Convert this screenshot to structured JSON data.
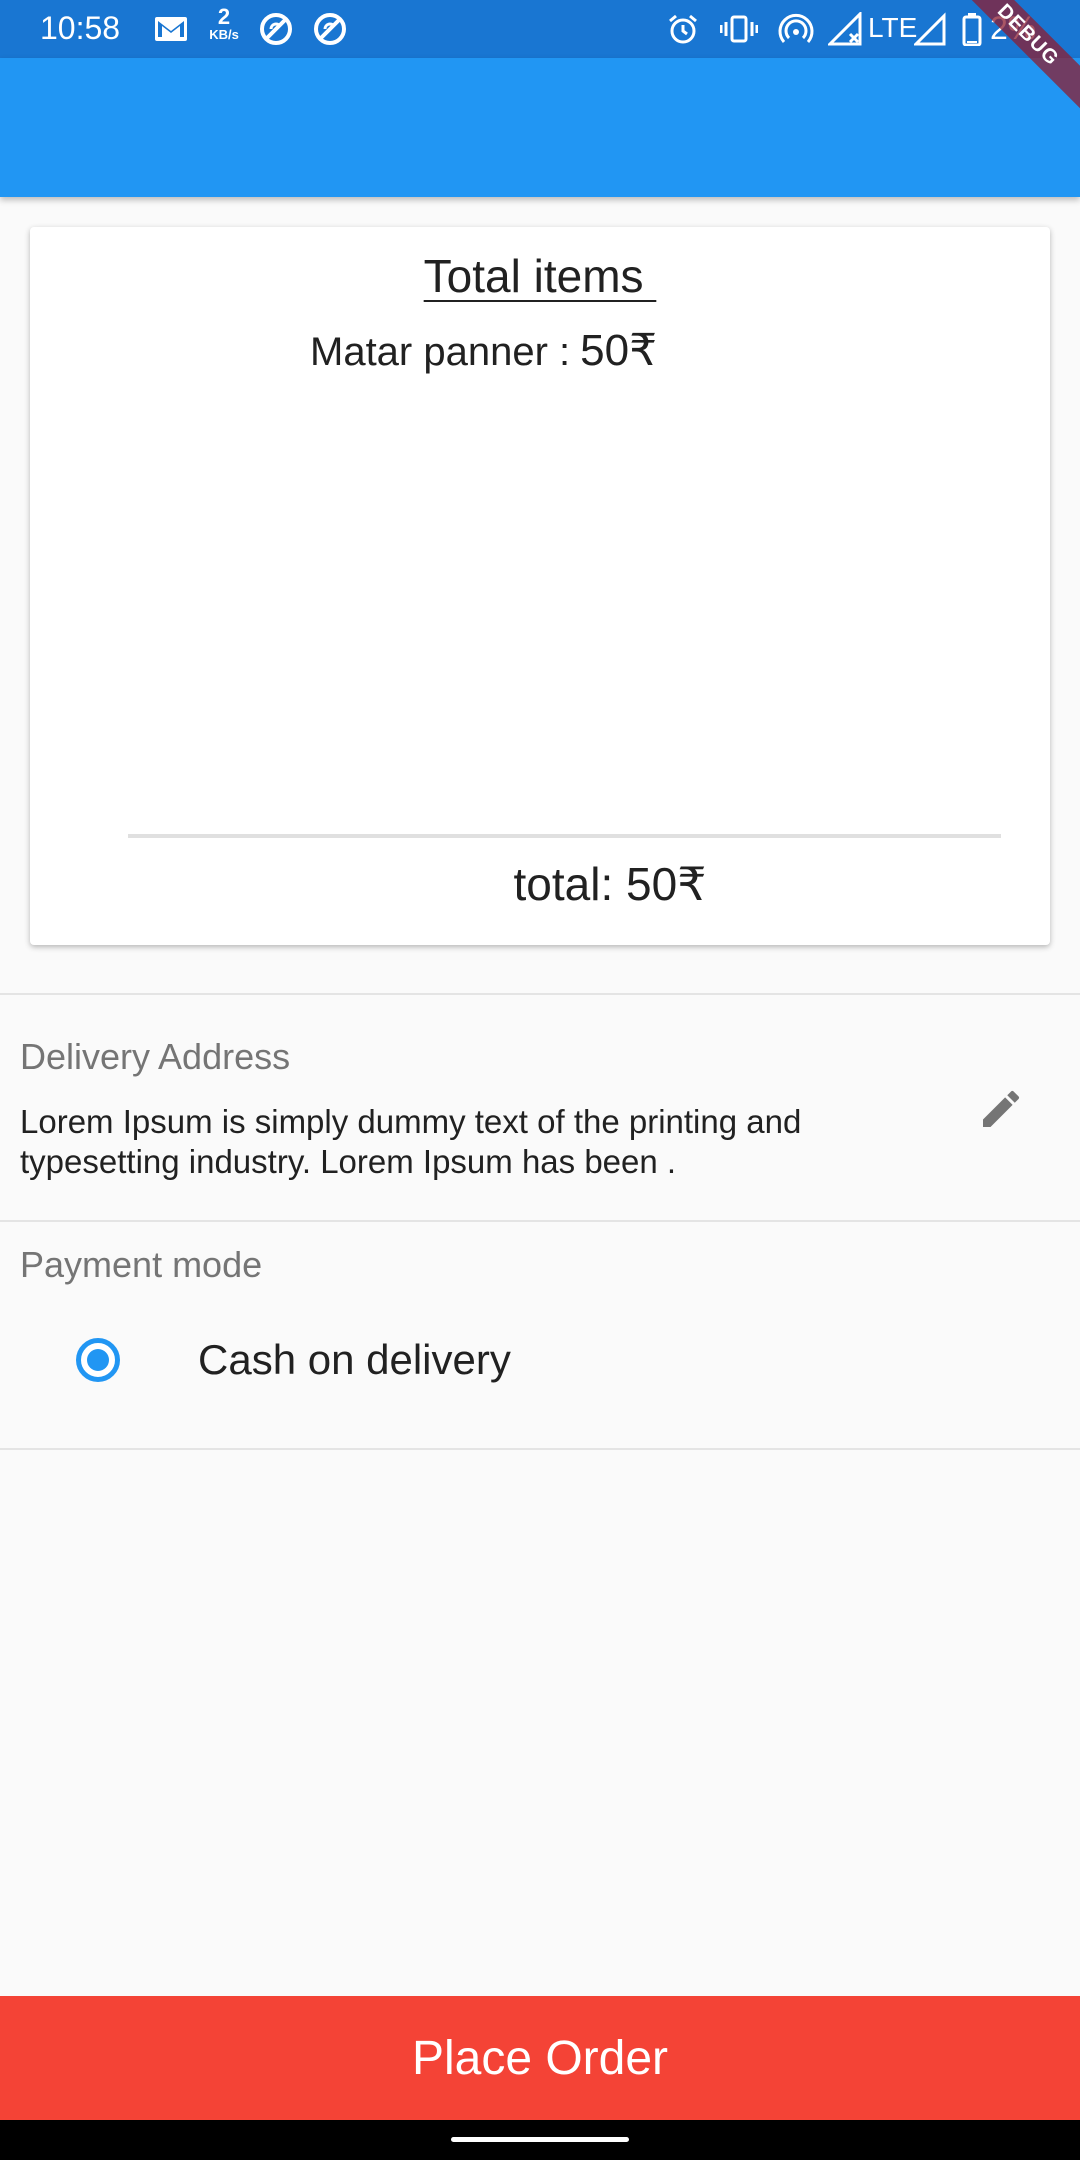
{
  "status_bar": {
    "time": "10:58",
    "net_speed_value": "2",
    "net_speed_unit": "KB/s",
    "network_type": "LTE",
    "battery_percent": "2%",
    "icons": [
      "gmail-icon",
      "no-sync-icon",
      "no-sync-icon",
      "alarm-icon",
      "vibrate-icon",
      "hotspot-icon",
      "signal-icon",
      "battery-icon"
    ]
  },
  "debug_banner": "DEBUG",
  "order_card": {
    "title": "Total items ",
    "items": [
      {
        "name": "Matar panner :",
        "price": "50₹"
      }
    ],
    "total": "total: 50₹"
  },
  "delivery": {
    "label": "Delivery Address",
    "address": "Lorem Ipsum is simply dummy text of the printing and typesetting industry. Lorem Ipsum has been ."
  },
  "payment": {
    "label": "Payment mode",
    "selected_option": "Cash on delivery"
  },
  "place_order_label": "Place Order",
  "colors": {
    "status_bar": "#1976d2",
    "app_bar": "#2196f3",
    "accent": "#2196f3",
    "place_order": "#f44336",
    "background": "#fafafa"
  }
}
